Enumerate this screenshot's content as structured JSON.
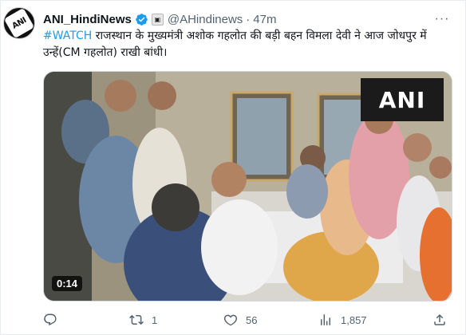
{
  "account": {
    "display_name": "ANI_HindiNews",
    "handle": "@AHindinews",
    "time": "47m",
    "avatar_text": "ANI"
  },
  "tweet": {
    "hashtag": "#WATCH",
    "text": " राजस्थान के मुख्यमंत्री अशोक गहलोत की बड़ी बहन विमला देवी ने आज जोधपुर में उन्हें(CM गहलोत) राखी बांधी।"
  },
  "media": {
    "duration": "0:14",
    "watermark": "ANI"
  },
  "actions": {
    "replies": "",
    "retweets": "1",
    "likes": "56",
    "views": "1,857"
  },
  "colors": {
    "link": "#1d9bf0",
    "muted": "#536471",
    "verified": "#1d9bf0"
  }
}
